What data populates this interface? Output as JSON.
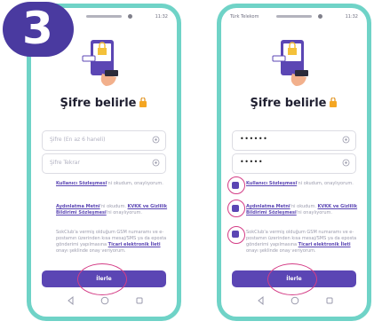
{
  "step": {
    "number": "3"
  },
  "colors": {
    "accent": "#5b46b4",
    "frame": "#6fd3c7",
    "badge": "#4a3aa0",
    "annotation": "#d43d86"
  },
  "status_bar": {
    "carrier": "Türk Telekom",
    "time": "11:32"
  },
  "screen": {
    "title": "Şifre belirle",
    "title_icon": "lock-icon",
    "password_placeholder": "Şifre (En az 6 haneli)",
    "password_confirm_placeholder": "Şifre Tekrar",
    "password_value_masked": "••••••",
    "password_confirm_value_masked": "•••••",
    "consent_1": {
      "link": "Kullanıcı Sözleşmesi",
      "rest": "'ni okudum, onaylıyorum."
    },
    "consent_2": {
      "link_a": "Aydınlatma Metni",
      "mid": "'ni okudum. ",
      "link_b": "KVKK ve Gizlilik Bildirimi Sözleşmesi",
      "rest": "'ni onaylıyorum."
    },
    "consent_3": {
      "text": "SokClub'a vermiş olduğum GSM numaramı ve e-postamın üzerinden kısa mesaj/SMS ya da eposta gönderimi yapılmasına ",
      "link": "Ticari elektronik İleti",
      "rest": " onayı şeklinde onay veriyorum."
    },
    "continue_label": "İlerle"
  },
  "phones": [
    {
      "state": "empty",
      "consent_checked": [
        false,
        false,
        false
      ]
    },
    {
      "state": "filled",
      "consent_checked": [
        true,
        true,
        true
      ]
    }
  ],
  "nav": {
    "back_icon": "back-triangle-icon",
    "home_icon": "home-circle-icon",
    "recent_icon": "recent-square-icon"
  }
}
